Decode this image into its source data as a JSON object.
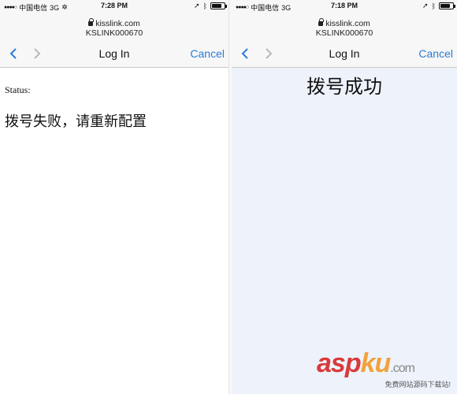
{
  "left": {
    "status_bar": {
      "carrier": "中国电信",
      "network": "3G",
      "time": "7:28 PM"
    },
    "url": "kisslink.com",
    "subtitle": "KSLINK000670",
    "nav": {
      "title": "Log In",
      "cancel_label": "Cancel"
    },
    "content": {
      "status_label": "Status:",
      "message": "拨号失败，请重新配置"
    }
  },
  "right": {
    "status_bar": {
      "carrier": "中国电信",
      "network": "3G",
      "time": "7:18 PM"
    },
    "url": "kisslink.com",
    "subtitle": "KSLINK000670",
    "nav": {
      "title": "Log In",
      "cancel_label": "Cancel"
    },
    "content": {
      "message": "拨号成功"
    }
  },
  "watermark": {
    "asp": "asp",
    "ku": "ku",
    "com": ".com",
    "sub": "免费网站源码下载站!"
  },
  "colors": {
    "accent": "#2b7bd6",
    "right_bg": "#eef2fb"
  }
}
